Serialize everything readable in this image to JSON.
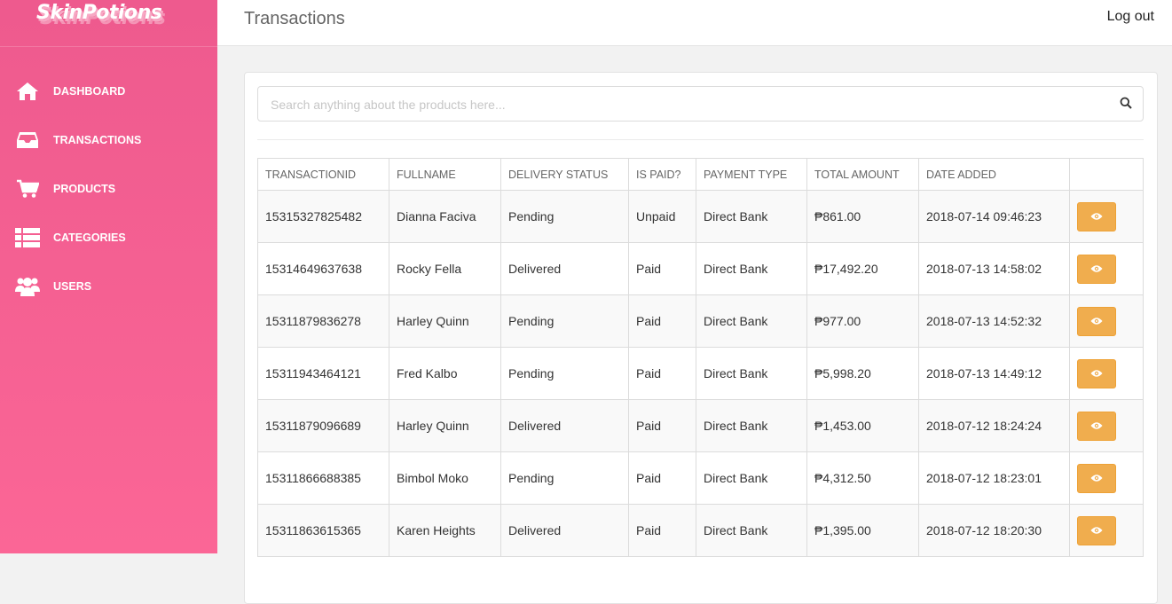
{
  "brand": {
    "logo_text": "SkinPotions"
  },
  "sidebar": {
    "items": [
      {
        "label": "DASHBOARD",
        "icon": "home-icon"
      },
      {
        "label": "TRANSACTIONS",
        "icon": "inbox-icon"
      },
      {
        "label": "PRODUCTS",
        "icon": "cart-icon"
      },
      {
        "label": "CATEGORIES",
        "icon": "list-icon"
      },
      {
        "label": "USERS",
        "icon": "users-icon"
      }
    ]
  },
  "header": {
    "title": "Transactions",
    "logout_label": "Log out"
  },
  "search": {
    "placeholder": "Search anything about the products here...",
    "value": ""
  },
  "table": {
    "columns": [
      "TRANSACTIONID",
      "FULLNAME",
      "DELIVERY STATUS",
      "IS PAID?",
      "PAYMENT TYPE",
      "TOTAL AMOUNT",
      "DATE ADDED",
      ""
    ],
    "rows": [
      [
        "15315327825482",
        "Dianna Faciva",
        "Pending",
        "Unpaid",
        "Direct Bank",
        "₱861.00",
        "2018-07-14 09:46:23"
      ],
      [
        "15314649637638",
        "Rocky Fella",
        "Delivered",
        "Paid",
        "Direct Bank",
        "₱17,492.20",
        "2018-07-13 14:58:02"
      ],
      [
        "15311879836278",
        "Harley Quinn",
        "Pending",
        "Paid",
        "Direct Bank",
        "₱977.00",
        "2018-07-13 14:52:32"
      ],
      [
        "15311943464121",
        "Fred Kalbo",
        "Pending",
        "Paid",
        "Direct Bank",
        "₱5,998.20",
        "2018-07-13 14:49:12"
      ],
      [
        "15311879096689",
        "Harley Quinn",
        "Delivered",
        "Paid",
        "Direct Bank",
        "₱1,453.00",
        "2018-07-12 18:24:24"
      ],
      [
        "15311866688385",
        "Bimbol Moko",
        "Pending",
        "Paid",
        "Direct Bank",
        "₱4,312.50",
        "2018-07-12 18:23:01"
      ],
      [
        "15311863615365",
        "Karen Heights",
        "Delivered",
        "Paid",
        "Direct Bank",
        "₱1,395.00",
        "2018-07-12 18:20:30"
      ]
    ],
    "action_icon": "eye-icon"
  },
  "colors": {
    "sidebar_top": "#ee5a8e",
    "sidebar_bottom": "#fb6696",
    "view_button": "#f0ad4e"
  }
}
